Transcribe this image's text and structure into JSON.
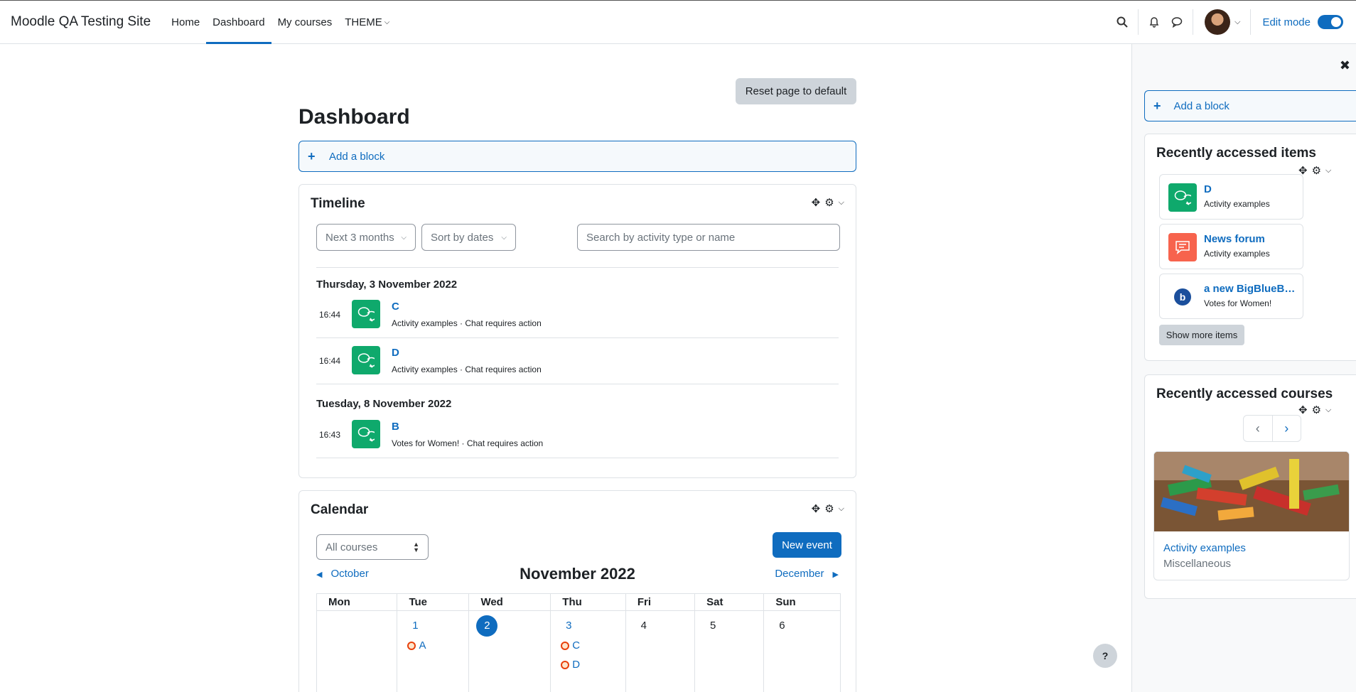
{
  "navbar": {
    "site_name": "Moodle QA Testing Site",
    "links": [
      "Home",
      "Dashboard",
      "My courses",
      "THEME"
    ],
    "edit_mode_label": "Edit mode"
  },
  "page": {
    "reset_label": "Reset page to default",
    "title": "Dashboard",
    "add_block_label": "Add a block"
  },
  "timeline": {
    "title": "Timeline",
    "filter_label": "Next 3 months",
    "sort_label": "Sort by dates",
    "search_placeholder": "Search by activity type or name",
    "groups": [
      {
        "date": "Thursday, 3 November 2022",
        "items": [
          {
            "time": "16:44",
            "name": "C",
            "sub": "Activity examples · Chat requires action"
          },
          {
            "time": "16:44",
            "name": "D",
            "sub": "Activity examples · Chat requires action"
          }
        ]
      },
      {
        "date": "Tuesday, 8 November 2022",
        "items": [
          {
            "time": "16:43",
            "name": "B",
            "sub": "Votes for Women! · Chat requires action"
          }
        ]
      }
    ]
  },
  "calendar": {
    "title": "Calendar",
    "course_filter": "All courses",
    "new_event_label": "New event",
    "prev_month": "October",
    "next_month": "December",
    "month_title": "November 2022",
    "weekdays": [
      "Mon",
      "Tue",
      "Wed",
      "Thu",
      "Fri",
      "Sat",
      "Sun"
    ],
    "days": [
      {
        "day": "",
        "events": []
      },
      {
        "day": "1",
        "events": [
          "A"
        ]
      },
      {
        "day": "2",
        "events": []
      },
      {
        "day": "3",
        "events": [
          "C",
          "D"
        ]
      },
      {
        "day": "4",
        "events": []
      },
      {
        "day": "5",
        "events": []
      },
      {
        "day": "6",
        "events": []
      }
    ]
  },
  "drawer": {
    "add_block_label": "Add a block",
    "recent_items_title": "Recently accessed items",
    "recent_items": [
      {
        "name": "D",
        "sub": "Activity examples",
        "icon": "chat-icon",
        "color": "#0fa96c"
      },
      {
        "name": "News forum",
        "sub": "Activity examples",
        "icon": "forum-icon",
        "color": "#f7634d"
      },
      {
        "name": "a new BigBlueButton",
        "sub": "Votes for Women!",
        "icon": "bigbluebutton-icon",
        "color": "#ffffff"
      }
    ],
    "show_more_label": "Show more items",
    "recent_courses_title": "Recently accessed courses",
    "course": {
      "name": "Activity examples",
      "category": "Miscellaneous"
    }
  },
  "colors": {
    "primary": "#0f6cbf",
    "chat": "#0fa96c",
    "forum": "#f7634d"
  }
}
